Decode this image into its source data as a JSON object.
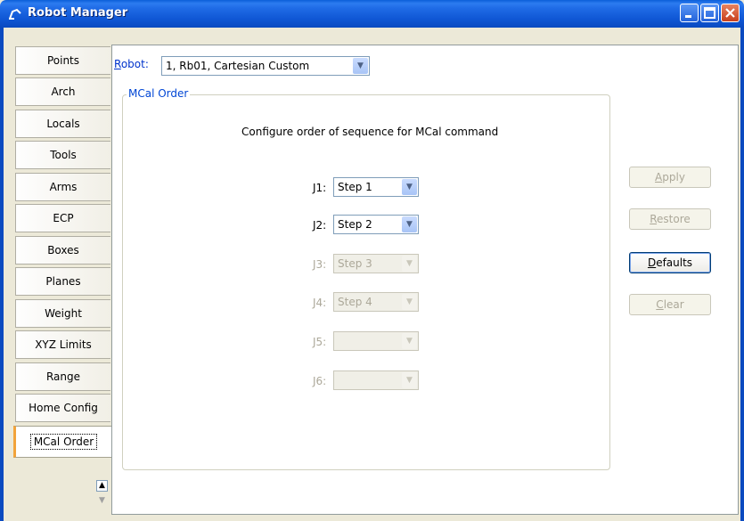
{
  "window": {
    "title": "Robot Manager"
  },
  "tabs": [
    {
      "label": "Points"
    },
    {
      "label": "Arch"
    },
    {
      "label": "Locals"
    },
    {
      "label": "Tools"
    },
    {
      "label": "Arms"
    },
    {
      "label": "ECP"
    },
    {
      "label": "Boxes"
    },
    {
      "label": "Planes"
    },
    {
      "label": "Weight"
    },
    {
      "label": "XYZ Limits"
    },
    {
      "label": "Range"
    },
    {
      "label": "Home Config"
    },
    {
      "label": "MCal Order"
    }
  ],
  "active_tab": "MCal Order",
  "robot": {
    "label_underlined": "R",
    "label_rest": "obot:",
    "value": "1, Rb01, Cartesian Custom"
  },
  "group": {
    "title": "MCal Order",
    "description": "Configure order of sequence for MCal command"
  },
  "joints": [
    {
      "label": "J1:",
      "value": "Step 1",
      "enabled": true
    },
    {
      "label": "J2:",
      "value": "Step 2",
      "enabled": true
    },
    {
      "label": "J3:",
      "value": "Step 3",
      "enabled": false
    },
    {
      "label": "J4:",
      "value": "Step 4",
      "enabled": false
    },
    {
      "label": "J5:",
      "value": "",
      "enabled": false
    },
    {
      "label": "J6:",
      "value": "",
      "enabled": false
    }
  ],
  "buttons": {
    "apply": {
      "u": "A",
      "rest": "pply",
      "enabled": false
    },
    "restore": {
      "u": "R",
      "rest": "estore",
      "enabled": false
    },
    "defaults": {
      "u": "D",
      "rest": "efaults",
      "enabled": true
    },
    "clear": {
      "u": "C",
      "rest": "lear",
      "enabled": false
    }
  }
}
